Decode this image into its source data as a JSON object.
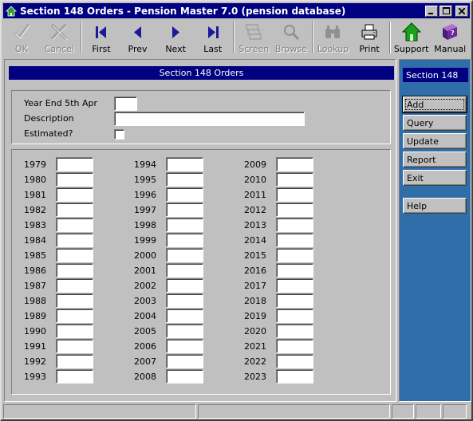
{
  "window": {
    "title": "Section 148 Orders - Pension Master 7.0 (pension database)"
  },
  "toolbar": {
    "ok": "OK",
    "cancel": "Cancel",
    "first": "First",
    "prev": "Prev",
    "next": "Next",
    "last": "Last",
    "screen": "Screen",
    "browse": "Browse",
    "lookup": "Lookup",
    "print": "Print",
    "support": "Support",
    "manual": "Manual"
  },
  "form": {
    "title": "Section 148 Orders",
    "year_end_label": "Year End 5th Apr",
    "year_end_value": "",
    "description_label": "Description",
    "description_value": "",
    "estimated_label": "Estimated?",
    "estimated_checked": false
  },
  "years": {
    "col1": [
      "1979",
      "1980",
      "1981",
      "1982",
      "1983",
      "1984",
      "1985",
      "1986",
      "1987",
      "1988",
      "1989",
      "1990",
      "1991",
      "1992",
      "1993"
    ],
    "col2": [
      "1994",
      "1995",
      "1996",
      "1997",
      "1998",
      "1999",
      "2000",
      "2001",
      "2002",
      "2003",
      "2004",
      "2005",
      "2006",
      "2007",
      "2008"
    ],
    "col3": [
      "2009",
      "2010",
      "2011",
      "2012",
      "2013",
      "2014",
      "2015",
      "2016",
      "2017",
      "2018",
      "2019",
      "2020",
      "2021",
      "2022",
      "2023"
    ]
  },
  "side": {
    "title": "Section 148",
    "add": "Add",
    "query": "Query",
    "update": "Update",
    "report": "Report",
    "exit": "Exit",
    "help": "Help"
  },
  "colors": {
    "titlebar": "#000080",
    "side_panel": "#2f6ea9",
    "face": "#c0c0c0",
    "nav_blue": "#1a1a9a",
    "support_green": "#1aa01a",
    "manual_purple": "#6a2a9a"
  }
}
